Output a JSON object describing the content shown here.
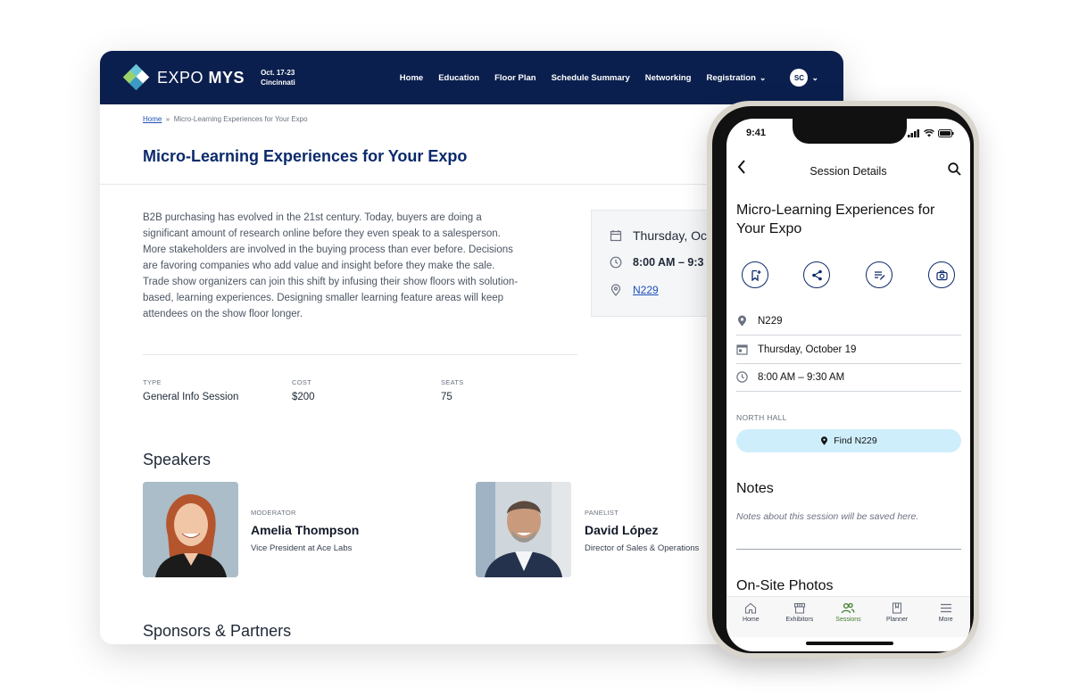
{
  "site": {
    "brand_light": "EXPO",
    "brand_bold": "MYS",
    "dates_line1": "Oct. 17-23",
    "dates_line2": "Cincinnati",
    "nav": [
      "Home",
      "Education",
      "Floor Plan",
      "Schedule Summary",
      "Networking",
      "Registration"
    ],
    "user_initials": "SC"
  },
  "breadcrumb": {
    "home": "Home",
    "sep": "»",
    "current": "Micro-Learning Experiences for Your Expo"
  },
  "session": {
    "title": "Micro-Learning Experiences for Your Expo",
    "description": "B2B purchasing has evolved in the 21st century. Today, buyers are doing a significant amount of research online before they even speak to a salesperson. More stakeholders are involved in the buying process than ever before. Decisions are favoring companies who add value and insight before they make the sale. Trade show organizers can join this shift by infusing their show floors with solution-based, learning experiences. Designing smaller learning feature areas will keep attendees on the show floor longer.",
    "type_label": "TYPE",
    "type_value": "General Info Session",
    "cost_label": "COST",
    "cost_value": "$200",
    "seats_label": "SEATS",
    "seats_value": "75",
    "info_date": "Thursday, Oct",
    "info_time": "8:00 AM – 9:3",
    "info_room": "N229"
  },
  "speakers": {
    "heading": "Speakers",
    "items": [
      {
        "role": "MODERATOR",
        "name": "Amelia Thompson",
        "title": "Vice President at Ace Labs"
      },
      {
        "role": "PANELIST",
        "name": "David López",
        "title": "Director of Sales & Operations"
      }
    ]
  },
  "sponsors_heading": "Sponsors & Partners",
  "mobile": {
    "time": "9:41",
    "appbar_title": "Session Details",
    "title": "Micro-Learning Experiences for Your Expo",
    "room": "N229",
    "date": "Thursday, October 19",
    "time_range": "8:00 AM – 9:30 AM",
    "hall": "NORTH HALL",
    "find_label": "Find N229",
    "notes_heading": "Notes",
    "notes_placeholder": "Notes about this session will be saved here.",
    "photos_heading": "On-Site Photos",
    "tabs": [
      "Home",
      "Exhibitors",
      "Sessions",
      "Planner",
      "More"
    ]
  },
  "colors": {
    "navy": "#0b1f4e",
    "title_blue": "#0b2a6b",
    "find_bg": "#cfeefc",
    "active_tab": "#3f7d2a"
  }
}
